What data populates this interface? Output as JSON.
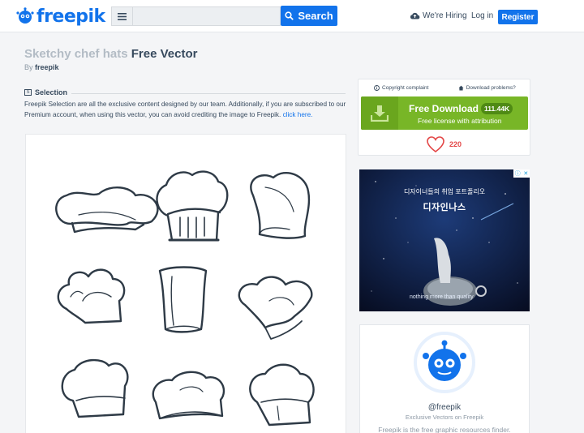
{
  "header": {
    "logo_text": "freepik",
    "search_placeholder": "",
    "search_button": "Search",
    "hiring": "We're Hiring",
    "login": "Log in",
    "register": "Register"
  },
  "resource": {
    "title_muted": "Sketchy chef hats",
    "title_strong": "Free Vector",
    "by_label": "By",
    "author": "freepik"
  },
  "selection": {
    "icon_glyph": "S",
    "label": "Selection",
    "text": "Freepik Selection are all the exclusive content designed by our team. Additionally, if you are subscribed to our Premium account, when using this vector, you can avoid crediting the image to Freepik.",
    "link": "click here."
  },
  "download": {
    "copyright": "Copyright complaint",
    "problems": "Download problems?",
    "button_title": "Free Download",
    "count": "111.44K",
    "subtitle": "Free license with attribution",
    "likes": "220"
  },
  "ad": {
    "title": "디자이너들의 취업 포트폴리오",
    "brand": "디자인나스",
    "tagline": "nothing more than quality"
  },
  "author_card": {
    "handle": "@freepik",
    "tagline": "Exclusive Vectors on Freepik",
    "description": "Freepik is the free graphic resources finder."
  },
  "colors": {
    "brand_blue": "#1273eb",
    "download_green": "#78b627",
    "like_red": "#e34646",
    "text_dark": "#374a5e"
  }
}
